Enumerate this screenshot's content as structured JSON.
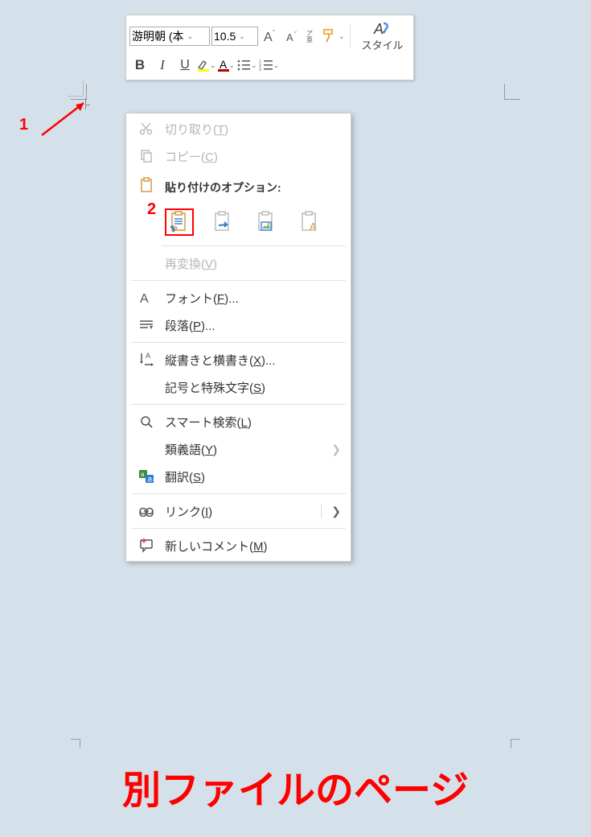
{
  "toolbar": {
    "font_name": "游明朝 (本",
    "font_size": "10.5",
    "style_label": "スタイル"
  },
  "annotations": {
    "num1": "1",
    "num2": "2"
  },
  "menu": {
    "cut": "切り取り(T)",
    "copy": "コピー(C)",
    "paste_header": "貼り付けのオプション:",
    "reconvert": "再変換(V)",
    "font": "フォント(F)...",
    "paragraph": "段落(P)...",
    "direction": "縦書きと横書き(X)...",
    "symbols": "記号と特殊文字(S)",
    "smart_lookup": "スマート検索(L)",
    "synonyms": "類義語(Y)",
    "translate": "翻訳(S)",
    "link": "リンク(I)",
    "new_comment": "新しいコメント(M)"
  },
  "caption": "別ファイルのページ"
}
